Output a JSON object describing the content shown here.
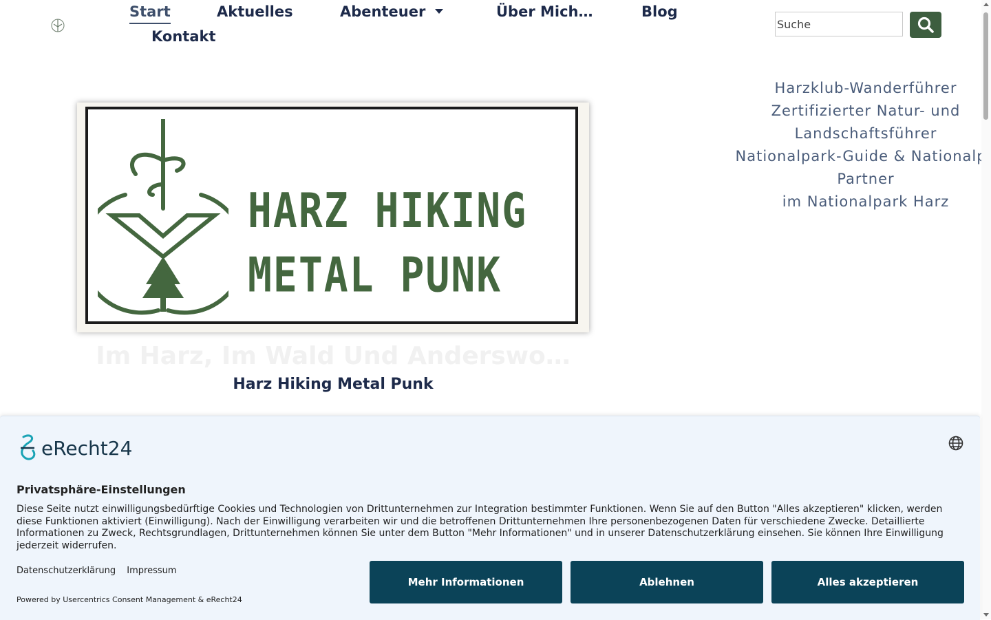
{
  "header": {
    "nav": [
      {
        "label": "Start",
        "active": true
      },
      {
        "label": "Aktuelles"
      },
      {
        "label": "Abenteuer",
        "has_dropdown": true
      },
      {
        "label": "Über Mich…"
      },
      {
        "label": "Blog"
      },
      {
        "label": "Kontakt"
      }
    ],
    "search": {
      "placeholder": "Suche",
      "icon": "search-icon"
    }
  },
  "hero": {
    "logo_text_line1": "HARZ HIKING",
    "logo_text_line2": "METAL PUNK",
    "tagline": "Im Harz, Im Wald Und Anderswo…",
    "site_name": "Harz Hiking Metal Punk"
  },
  "credentials": [
    "Harzklub-Wanderführer",
    "Zertifizierter Natur- und",
    "Landschaftsführer",
    "Nationalpark-Guide & Nationalpa",
    "Partner",
    "im Nationalpark Harz"
  ],
  "consent": {
    "brand": "eRecht24",
    "title": "Privatsphäre-Einstellungen",
    "body": "Diese Seite nutzt einwilligungsbedürftige Cookies und Technologien von Drittunternehmen zur Integration bestimmter Funktionen. Wenn Sie auf den Button \"Alles akzeptieren\" klicken, werden diese Funktionen aktiviert (Einwilligung). Nach der Einwilligung verarbeiten wir und die betroffenen Drittunternehmen Ihre personenbezogenen Daten für verschiedene Zwecke. Detaillierte Informationen zu Zweck, Rechtsgrundlagen, Drittunternehmen können Sie unter dem Button \"Mehr Informationen\" und in unserer Datenschutzerklärung einsehen. Sie können Ihre Einwilligung jederzeit widerrufen.",
    "links": [
      "Datenschutzerklärung",
      "Impressum"
    ],
    "powered_by": "Powered by Usercentrics Consent Management & eRecht24",
    "buttons": {
      "more": "Mehr Informationen",
      "decline": "Ablehnen",
      "accept": "Alles akzeptieren"
    }
  },
  "colors": {
    "accent_green": "#3d5e3f",
    "logo_green": "#44673f",
    "navy": "#1d2a4a",
    "consent_button": "#0b4358"
  }
}
